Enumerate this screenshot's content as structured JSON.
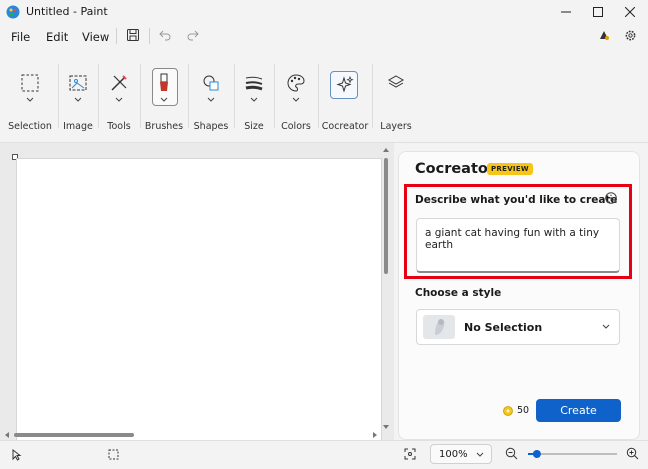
{
  "window": {
    "title": "Untitled - Paint"
  },
  "menu": {
    "file": "File",
    "edit": "Edit",
    "view": "View"
  },
  "ribbon": {
    "groups": [
      {
        "label": "Selection",
        "icon": "selection-icon"
      },
      {
        "label": "Image",
        "icon": "image-icon"
      },
      {
        "label": "Tools",
        "icon": "tools-icon"
      },
      {
        "label": "Brushes",
        "icon": "brush-icon"
      },
      {
        "label": "Shapes",
        "icon": "shapes-icon"
      },
      {
        "label": "Size",
        "icon": "size-icon"
      },
      {
        "label": "Colors",
        "icon": "palette-icon"
      },
      {
        "label": "Cocreator",
        "icon": "sparkle-icon"
      },
      {
        "label": "Layers",
        "icon": "layers-icon"
      }
    ]
  },
  "cocreator": {
    "title": "Cocreator",
    "badge": "PREVIEW",
    "prompt_label": "Describe what you'd like to create",
    "prompt_text": "a giant cat having fun with a tiny earth",
    "style_label": "Choose a style",
    "style_value": "No Selection",
    "credits": "50",
    "create_label": "Create"
  },
  "status": {
    "zoom": "100%",
    "zoom_level": 0.1
  },
  "colors": {
    "accent": "#0f62c9",
    "highlight": "#e60012",
    "badge": "#f5c518"
  }
}
